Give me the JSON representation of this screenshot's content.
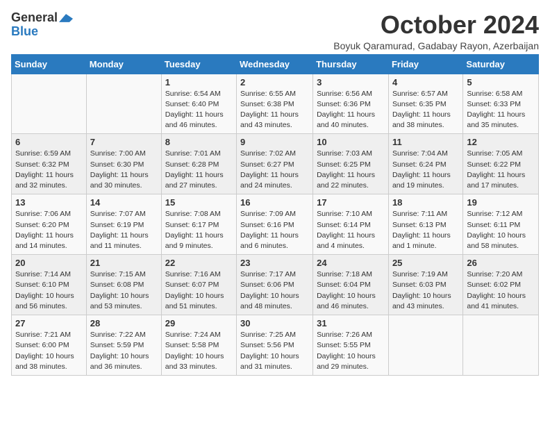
{
  "header": {
    "logo_general": "General",
    "logo_blue": "Blue",
    "month": "October 2024",
    "location": "Boyuk Qaramurad, Gadabay Rayon, Azerbaijan"
  },
  "days_of_week": [
    "Sunday",
    "Monday",
    "Tuesday",
    "Wednesday",
    "Thursday",
    "Friday",
    "Saturday"
  ],
  "weeks": [
    [
      {
        "day": "",
        "info": ""
      },
      {
        "day": "",
        "info": ""
      },
      {
        "day": "1",
        "info": "Sunrise: 6:54 AM\nSunset: 6:40 PM\nDaylight: 11 hours and 46 minutes."
      },
      {
        "day": "2",
        "info": "Sunrise: 6:55 AM\nSunset: 6:38 PM\nDaylight: 11 hours and 43 minutes."
      },
      {
        "day": "3",
        "info": "Sunrise: 6:56 AM\nSunset: 6:36 PM\nDaylight: 11 hours and 40 minutes."
      },
      {
        "day": "4",
        "info": "Sunrise: 6:57 AM\nSunset: 6:35 PM\nDaylight: 11 hours and 38 minutes."
      },
      {
        "day": "5",
        "info": "Sunrise: 6:58 AM\nSunset: 6:33 PM\nDaylight: 11 hours and 35 minutes."
      }
    ],
    [
      {
        "day": "6",
        "info": "Sunrise: 6:59 AM\nSunset: 6:32 PM\nDaylight: 11 hours and 32 minutes."
      },
      {
        "day": "7",
        "info": "Sunrise: 7:00 AM\nSunset: 6:30 PM\nDaylight: 11 hours and 30 minutes."
      },
      {
        "day": "8",
        "info": "Sunrise: 7:01 AM\nSunset: 6:28 PM\nDaylight: 11 hours and 27 minutes."
      },
      {
        "day": "9",
        "info": "Sunrise: 7:02 AM\nSunset: 6:27 PM\nDaylight: 11 hours and 24 minutes."
      },
      {
        "day": "10",
        "info": "Sunrise: 7:03 AM\nSunset: 6:25 PM\nDaylight: 11 hours and 22 minutes."
      },
      {
        "day": "11",
        "info": "Sunrise: 7:04 AM\nSunset: 6:24 PM\nDaylight: 11 hours and 19 minutes."
      },
      {
        "day": "12",
        "info": "Sunrise: 7:05 AM\nSunset: 6:22 PM\nDaylight: 11 hours and 17 minutes."
      }
    ],
    [
      {
        "day": "13",
        "info": "Sunrise: 7:06 AM\nSunset: 6:20 PM\nDaylight: 11 hours and 14 minutes."
      },
      {
        "day": "14",
        "info": "Sunrise: 7:07 AM\nSunset: 6:19 PM\nDaylight: 11 hours and 11 minutes."
      },
      {
        "day": "15",
        "info": "Sunrise: 7:08 AM\nSunset: 6:17 PM\nDaylight: 11 hours and 9 minutes."
      },
      {
        "day": "16",
        "info": "Sunrise: 7:09 AM\nSunset: 6:16 PM\nDaylight: 11 hours and 6 minutes."
      },
      {
        "day": "17",
        "info": "Sunrise: 7:10 AM\nSunset: 6:14 PM\nDaylight: 11 hours and 4 minutes."
      },
      {
        "day": "18",
        "info": "Sunrise: 7:11 AM\nSunset: 6:13 PM\nDaylight: 11 hours and 1 minute."
      },
      {
        "day": "19",
        "info": "Sunrise: 7:12 AM\nSunset: 6:11 PM\nDaylight: 10 hours and 58 minutes."
      }
    ],
    [
      {
        "day": "20",
        "info": "Sunrise: 7:14 AM\nSunset: 6:10 PM\nDaylight: 10 hours and 56 minutes."
      },
      {
        "day": "21",
        "info": "Sunrise: 7:15 AM\nSunset: 6:08 PM\nDaylight: 10 hours and 53 minutes."
      },
      {
        "day": "22",
        "info": "Sunrise: 7:16 AM\nSunset: 6:07 PM\nDaylight: 10 hours and 51 minutes."
      },
      {
        "day": "23",
        "info": "Sunrise: 7:17 AM\nSunset: 6:06 PM\nDaylight: 10 hours and 48 minutes."
      },
      {
        "day": "24",
        "info": "Sunrise: 7:18 AM\nSunset: 6:04 PM\nDaylight: 10 hours and 46 minutes."
      },
      {
        "day": "25",
        "info": "Sunrise: 7:19 AM\nSunset: 6:03 PM\nDaylight: 10 hours and 43 minutes."
      },
      {
        "day": "26",
        "info": "Sunrise: 7:20 AM\nSunset: 6:02 PM\nDaylight: 10 hours and 41 minutes."
      }
    ],
    [
      {
        "day": "27",
        "info": "Sunrise: 7:21 AM\nSunset: 6:00 PM\nDaylight: 10 hours and 38 minutes."
      },
      {
        "day": "28",
        "info": "Sunrise: 7:22 AM\nSunset: 5:59 PM\nDaylight: 10 hours and 36 minutes."
      },
      {
        "day": "29",
        "info": "Sunrise: 7:24 AM\nSunset: 5:58 PM\nDaylight: 10 hours and 33 minutes."
      },
      {
        "day": "30",
        "info": "Sunrise: 7:25 AM\nSunset: 5:56 PM\nDaylight: 10 hours and 31 minutes."
      },
      {
        "day": "31",
        "info": "Sunrise: 7:26 AM\nSunset: 5:55 PM\nDaylight: 10 hours and 29 minutes."
      },
      {
        "day": "",
        "info": ""
      },
      {
        "day": "",
        "info": ""
      }
    ]
  ]
}
